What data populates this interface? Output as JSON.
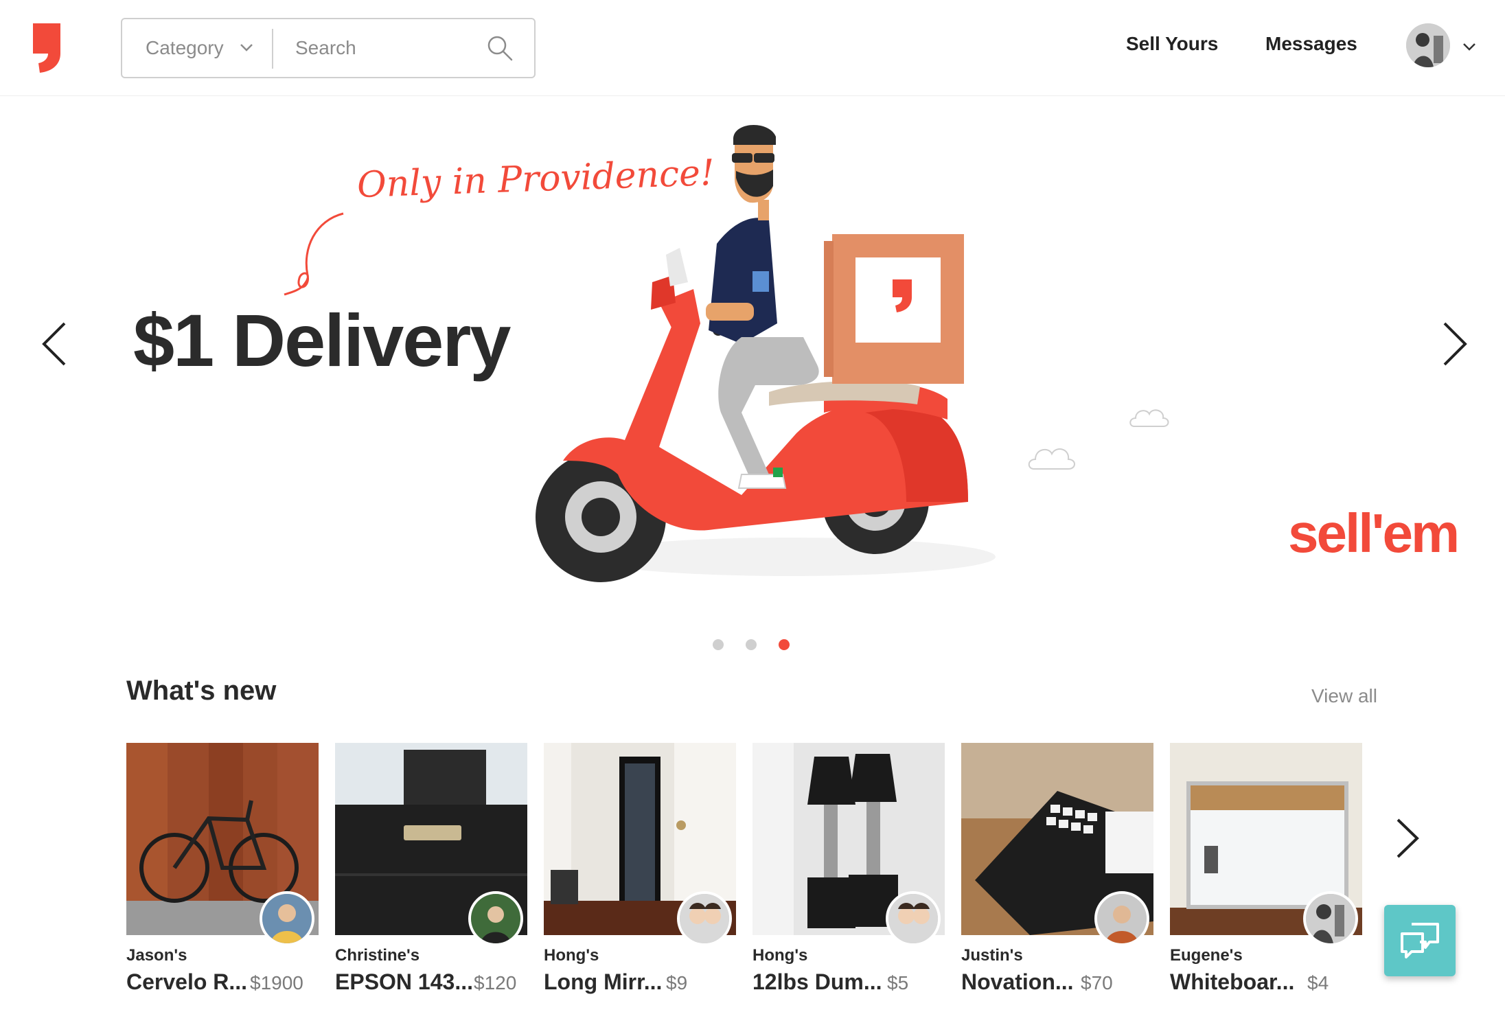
{
  "header": {
    "category_label": "Category",
    "search_placeholder": "Search",
    "nav": {
      "sell": "Sell Yours",
      "messages": "Messages"
    }
  },
  "hero": {
    "title": "$1 Delivery",
    "tagline": "Only in Providence!",
    "brand": "sell'em",
    "slides": {
      "count": 3,
      "active_index": 2
    }
  },
  "whats_new": {
    "title": "What's new",
    "view_all": "View all",
    "items": [
      {
        "owner": "Jason's",
        "name": "Cervelo R...",
        "price": "$1900"
      },
      {
        "owner": "Christine's",
        "name": "EPSON 143...",
        "price": "$120"
      },
      {
        "owner": "Hong's",
        "name": "Long Mirr...",
        "price": "$9"
      },
      {
        "owner": "Hong's",
        "name": "12lbs Dum...",
        "price": "$5"
      },
      {
        "owner": "Justin's",
        "name": "Novation...",
        "price": "$70"
      },
      {
        "owner": "Eugene's",
        "name": "Whiteboar...",
        "price": "$4"
      }
    ]
  },
  "colors": {
    "brand_red": "#f24a3a",
    "chat_teal": "#5ec7c7",
    "muted_text": "#8b8b8b"
  },
  "icons": {
    "logo": "comma-logo-icon",
    "search": "search-icon",
    "category_dropdown": "chevron-down-icon",
    "account_dropdown": "chevron-down-icon",
    "carousel_prev": "chevron-left-icon",
    "carousel_next": "chevron-right-icon",
    "items_next": "chevron-right-icon",
    "chat": "chat-bubbles-icon"
  }
}
